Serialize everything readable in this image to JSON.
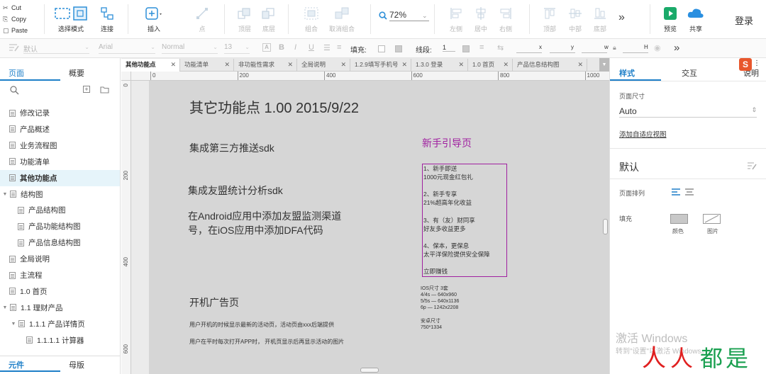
{
  "toolbar": {
    "edit_menu": [
      {
        "icon": "scissors-icon",
        "glyph": "✂",
        "label": "Cut"
      },
      {
        "icon": "copy-icon",
        "glyph": "⎘",
        "label": "Copy"
      },
      {
        "icon": "paste-icon",
        "glyph": "▢",
        "label": "Paste"
      }
    ],
    "select_mode": "选择模式",
    "connect": "连接",
    "insert": "插入",
    "point": "点",
    "top_layer": "顶层",
    "bottom_layer": "底层",
    "group": "组合",
    "ungroup": "取消组合",
    "zoom": "72%",
    "align_left": "左侧",
    "align_center": "居中",
    "align_right": "右侧",
    "align_top": "顶部",
    "align_middle": "中部",
    "align_bottom": "底部",
    "more": "»",
    "preview": "预览",
    "share": "共享",
    "login": "登录"
  },
  "format_bar": {
    "style": "默认",
    "font": "Arial",
    "weight": "Normal",
    "size": "13",
    "fill_label": "填充:",
    "line_label": "线段:",
    "line_width": "1",
    "x_label": "x",
    "y_label": "y",
    "w_label": "w",
    "h_label": "H",
    "more": "»"
  },
  "left_panel": {
    "tab_pages": "页面",
    "tab_outline": "概要",
    "pages": [
      {
        "label": "修改记录",
        "indent": 0,
        "toggle": ""
      },
      {
        "label": "产品概述",
        "indent": 0,
        "toggle": ""
      },
      {
        "label": "业务流程图",
        "indent": 0,
        "toggle": ""
      },
      {
        "label": "功能清单",
        "indent": 0,
        "toggle": ""
      },
      {
        "label": "其他功能点",
        "indent": 0,
        "toggle": "",
        "selected": true
      },
      {
        "label": "结构图",
        "indent": 0,
        "toggle": "▼"
      },
      {
        "label": "产品结构图",
        "indent": 1,
        "toggle": ""
      },
      {
        "label": "产品功能结构图",
        "indent": 1,
        "toggle": ""
      },
      {
        "label": "产品信息结构图",
        "indent": 1,
        "toggle": ""
      },
      {
        "label": "全局说明",
        "indent": 0,
        "toggle": ""
      },
      {
        "label": "主流程",
        "indent": 0,
        "toggle": ""
      },
      {
        "label": "1.0 首页",
        "indent": 0,
        "toggle": ""
      },
      {
        "label": "1.1 理财产品",
        "indent": 0,
        "toggle": "▼"
      },
      {
        "label": "1.1.1 产品详情页",
        "indent": 1,
        "toggle": "▼"
      },
      {
        "label": "1.1.1.1 计算器",
        "indent": 2,
        "toggle": ""
      }
    ],
    "tab_widgets": "元件",
    "tab_masters": "母版"
  },
  "doc_tabs": [
    {
      "label": "其他功能点",
      "active": true
    },
    {
      "label": "功能清单"
    },
    {
      "label": "非功能性需求"
    },
    {
      "label": "全局说明"
    },
    {
      "label": "1.2.9填写手机号"
    },
    {
      "label": "1.3.0 登录"
    },
    {
      "label": "1.0 首页"
    },
    {
      "label": "产品信息结构图"
    }
  ],
  "ruler": {
    "h_marks": [
      "0",
      "200",
      "400",
      "600",
      "800",
      "1000"
    ],
    "v_marks": [
      "0",
      "200",
      "400",
      "600"
    ]
  },
  "canvas": {
    "title": "其它功能点    1.00  2015/9/22",
    "push_sdk": "集成第三方推送sdk",
    "umeng_sdk": "集成友盟统计分析sdk",
    "channel_text_1": "在Android应用中添加友盟监测渠道",
    "channel_text_2": "号，在iOS应用中添加DFA代码",
    "ad_page_title": "开机广告页",
    "ad_desc_1": "用户开机的时候显示最新的活动页，活动页由xxx后端提供",
    "ad_desc_2": "用户在平时每次打开APP时， 开机页显示后再显示活动的图片",
    "guide_title": "新手引导页",
    "guide_lines": [
      "1、新手即送",
      "1000元现金红包礼",
      "",
      "2、新手专享",
      "21%超高年化收益",
      "",
      "3、有（友）财同享",
      "好友多收益更多",
      "",
      "4、保本，更保息",
      "太平洋保险提供安全保障",
      "",
      "立即赚钱"
    ],
    "ios_sizes": [
      "IOS尺寸 3套",
      "4/4s — 640x960",
      "5/5s — 640x1136",
      "6p — 1242x2208"
    ],
    "android_sizes": [
      "安卓尺寸",
      "750*1334"
    ],
    "guide_color": "#a020a0"
  },
  "right_panel": {
    "tab_style": "样式",
    "tab_interaction": "交互",
    "tab_notes": "说明",
    "page_size_label": "页面尺寸",
    "page_size_value": "Auto",
    "adaptive_link": "添加自适应视图",
    "style_name": "默认",
    "page_arrange_label": "页面排列",
    "fill_label": "填充",
    "color_label": "颜色",
    "image_label": "图片"
  },
  "watermark": {
    "title": "激活 Windows",
    "subtitle": "转到\"设置\"以激活 Windows。",
    "brand": "人人都是产品经理"
  },
  "colors": {
    "accent": "#1e7fc8",
    "preview_green": "#1aaa6a",
    "share_blue": "#2a8fe0"
  }
}
